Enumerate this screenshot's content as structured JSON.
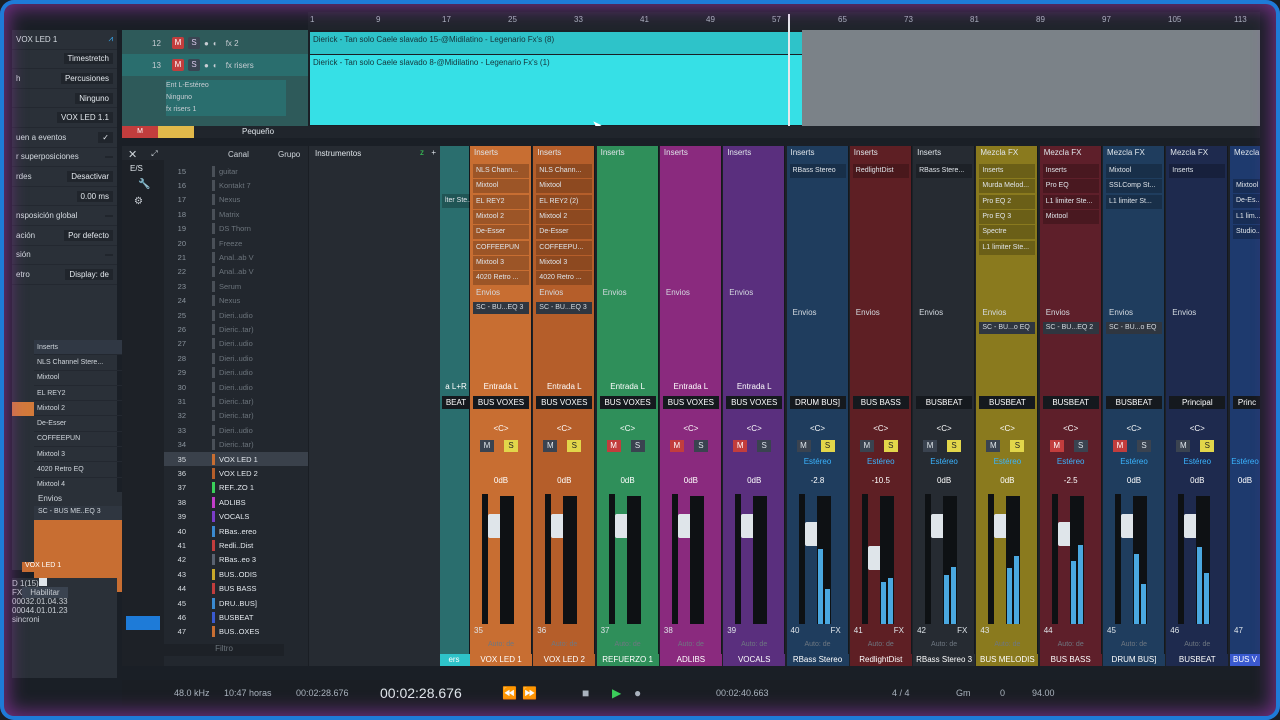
{
  "inspector": {
    "title": "VOX LED 1",
    "rows": [
      {
        "label": "",
        "value": "Timestretch"
      },
      {
        "label": "h",
        "value": "Percusiones"
      },
      {
        "label": "",
        "value": "Ninguno"
      },
      {
        "label": "",
        "value": "VOX LED 1.1"
      },
      {
        "label": "uen a eventos",
        "value": "✓"
      },
      {
        "label": "r superposiciones",
        "value": ""
      },
      {
        "label": "rdes",
        "value": "Desactivar"
      },
      {
        "label": "",
        "value": "0.00 ms"
      },
      {
        "label": "nsposición global",
        "value": ""
      },
      {
        "label": "ación",
        "value": "Por defecto"
      },
      {
        "label": "sión",
        "value": ""
      },
      {
        "label": "etro",
        "value": "Display: de"
      }
    ],
    "inserts_header": "Inserts",
    "inserts": [
      "NLS Channel Stere...",
      "Mixtool",
      "EL REY2",
      "Mixtool 2",
      "De-Esser",
      "COFFEEPUN",
      "Mixtool 3",
      "4020 Retro EQ",
      "Mixtool 4"
    ],
    "sends_header": "Envios",
    "send": "SC - BUS ME..EQ 3",
    "channel_label": "VOX LED 1",
    "bottom": {
      "event": "D 1(15)",
      "fx": "FX",
      "enable": "Habilitar",
      "t1": "00032.01.04.33",
      "t2": "00044.01.01.23",
      "sync": "sincroni"
    }
  },
  "arrange": {
    "tracks": [
      {
        "num": "12",
        "m": "M",
        "s": "S",
        "name": "fx 2"
      },
      {
        "num": "13",
        "m": "M",
        "s": "S",
        "name": "fx risers"
      }
    ],
    "track13_input": "Ent L-Estéreo",
    "track13_out": "Ninguno",
    "track13_sub": "fx risers 1",
    "ruler": [
      "1",
      "9",
      "17",
      "25",
      "33",
      "41",
      "49",
      "57",
      "65",
      "73",
      "81",
      "89",
      "97",
      "105",
      "113"
    ],
    "clip1": "Dierick - Tan solo Caele slavado 15-@Midilatino - Legenario Fx's (8)",
    "clip2": "Dierick - Tan solo Caele slavado 8-@Midilatino - Legenario Fx's (1)",
    "zoom": "Pequeño"
  },
  "list": {
    "headers": {
      "es": "E/S",
      "canal": "Canal",
      "grupo": "Grupo",
      "instr": "Instrumentos"
    },
    "filter": "Filtro",
    "aux": "AUX",
    "rows": [
      {
        "n": "15",
        "l": "guitar",
        "act": false
      },
      {
        "n": "16",
        "l": "Kontakt 7",
        "act": false
      },
      {
        "n": "17",
        "l": "Nexus",
        "act": false
      },
      {
        "n": "18",
        "l": "Matrix",
        "act": false
      },
      {
        "n": "19",
        "l": "DS Thorn",
        "act": false
      },
      {
        "n": "20",
        "l": "Freeze",
        "act": false
      },
      {
        "n": "21",
        "l": "Anal..ab V",
        "act": false
      },
      {
        "n": "22",
        "l": "Anal..ab V",
        "act": false
      },
      {
        "n": "23",
        "l": "Serum",
        "act": false
      },
      {
        "n": "24",
        "l": "Nexus",
        "act": false
      },
      {
        "n": "25",
        "l": "Dieri..udio",
        "act": false
      },
      {
        "n": "26",
        "l": "Dieric..tar)",
        "act": false
      },
      {
        "n": "27",
        "l": "Dieri..udio",
        "act": false
      },
      {
        "n": "28",
        "l": "Dieri..udio",
        "act": false
      },
      {
        "n": "29",
        "l": "Dieri..udio",
        "act": false
      },
      {
        "n": "30",
        "l": "Dieri..udio",
        "act": false
      },
      {
        "n": "31",
        "l": "Dieric..tar)",
        "act": false
      },
      {
        "n": "32",
        "l": "Dieric..tar)",
        "act": false
      },
      {
        "n": "33",
        "l": "Dieri..udio",
        "act": false
      },
      {
        "n": "34",
        "l": "Dieric..tar)",
        "act": false
      },
      {
        "n": "35",
        "l": "VOX LED 1",
        "act": true
      },
      {
        "n": "36",
        "l": "VOX LED 2",
        "act": true
      },
      {
        "n": "37",
        "l": "REF..ZO 1",
        "act": true
      },
      {
        "n": "38",
        "l": "ADLIBS",
        "act": true
      },
      {
        "n": "39",
        "l": "VOCALS",
        "act": true
      },
      {
        "n": "40",
        "l": "RBas..ereo",
        "act": true
      },
      {
        "n": "41",
        "l": "Redli..Dist",
        "act": true
      },
      {
        "n": "42",
        "l": "RBas..eo 3",
        "act": true
      },
      {
        "n": "43",
        "l": "BUS..ODIS",
        "act": true
      },
      {
        "n": "44",
        "l": "BUS BASS",
        "act": true
      },
      {
        "n": "45",
        "l": "DRU..BUS]",
        "act": true
      },
      {
        "n": "46",
        "l": "BUSBEAT",
        "act": true
      },
      {
        "n": "47",
        "l": "BUS..OXES",
        "act": true
      }
    ]
  },
  "mixer": {
    "partial_left": {
      "input": "a L+R",
      "bus": "BEAT",
      "name": "ers",
      "ins": "lter Ste...",
      "num": "3"
    },
    "channels": [
      {
        "num": "35",
        "color": "#c86e32",
        "top": "Inserts",
        "inserts": [
          "NLS Chann...",
          "Mixtool",
          "EL REY2",
          "Mixtool 2",
          "De-Esser",
          "COFFEEPUN",
          "Mixtool 3",
          "4020 Retro ..."
        ],
        "sends": "Envios",
        "send": "SC - BU...EQ 3",
        "input": "Entrada L",
        "bus": "BUS VOXES",
        "m": false,
        "s": true,
        "stereo": "",
        "gain": "0dB",
        "name": "VOX LED 1",
        "auto": "Auto: de",
        "fx": ""
      },
      {
        "num": "36",
        "color": "#b55e2a",
        "top": "Inserts",
        "inserts": [
          "NLS Chann...",
          "Mixtool",
          "EL REY2 (2)",
          "Mixtool 2",
          "De-Esser",
          "COFFEEPU...",
          "Mixtool 3",
          "4020 Retro ..."
        ],
        "sends": "Envios",
        "send": "SC - BU...EQ 3",
        "input": "Entrada L",
        "bus": "BUS VOXES",
        "m": false,
        "s": true,
        "stereo": "",
        "gain": "0dB",
        "name": "VOX LED 2",
        "auto": "Auto: de",
        "fx": ""
      },
      {
        "num": "37",
        "color": "#2f8f5a",
        "top": "Inserts",
        "inserts": [],
        "sends": "Envios",
        "send": "",
        "input": "Entrada L",
        "bus": "BUS VOXES",
        "m": true,
        "s": false,
        "stereo": "",
        "gain": "0dB",
        "name": "REFUERZO 1",
        "auto": "Auto: de",
        "fx": ""
      },
      {
        "num": "38",
        "color": "#8a2a7e",
        "top": "Inserts",
        "inserts": [],
        "sends": "Envios",
        "send": "",
        "input": "Entrada L",
        "bus": "BUS VOXES",
        "m": true,
        "s": false,
        "stereo": "",
        "gain": "0dB",
        "name": "ADLIBS",
        "auto": "Auto: de",
        "fx": ""
      },
      {
        "num": "39",
        "color": "#5a2f7e",
        "top": "Inserts",
        "inserts": [],
        "sends": "Envios",
        "send": "",
        "input": "Entrada L",
        "bus": "BUS VOXES",
        "m": true,
        "s": false,
        "stereo": "",
        "gain": "0dB",
        "name": "VOCALS",
        "auto": "Auto: de",
        "fx": ""
      },
      {
        "num": "40",
        "color": "#1f3d5e",
        "top": "Inserts",
        "inserts": [
          "RBass Stereo"
        ],
        "sends": "Envios",
        "send": "",
        "input": "",
        "bus": "DRUM BUS]",
        "m": false,
        "s": true,
        "stereo": "Estéreo",
        "gain": "-2.8",
        "name": "RBass Stereo",
        "auto": "Auto: de",
        "fx": "FX"
      },
      {
        "num": "41",
        "color": "#5e1f24",
        "top": "Inserts",
        "inserts": [
          "RedlightDist"
        ],
        "sends": "Envios",
        "send": "",
        "input": "",
        "bus": "BUS BASS",
        "m": false,
        "s": true,
        "stereo": "Estéreo",
        "gain": "-10.5",
        "name": "RedlightDist",
        "auto": "Auto: de",
        "fx": "FX"
      },
      {
        "num": "42",
        "color": "#262b32",
        "top": "Inserts",
        "inserts": [
          "RBass Stere..."
        ],
        "sends": "Envios",
        "send": "",
        "input": "",
        "bus": "BUSBEAT",
        "m": false,
        "s": true,
        "stereo": "Estéreo",
        "gain": "0dB",
        "name": "RBass Stereo 3",
        "auto": "Auto: de",
        "fx": "FX"
      },
      {
        "num": "43",
        "color": "#8a7a1e",
        "top": "Mezcla FX",
        "inserts": [
          "Inserts",
          "Murda Melod...",
          "Pro EQ 2",
          "Pro EQ 3",
          "Spectre",
          "L1 limiter Ste..."
        ],
        "sends": "Envios",
        "send": "SC - BU...o EQ",
        "input": "",
        "bus": "BUSBEAT",
        "m": false,
        "s": true,
        "stereo": "Estéreo",
        "gain": "0dB",
        "name": "BUS MELODIS",
        "auto": "Auto: de",
        "fx": ""
      },
      {
        "num": "44",
        "color": "#5e1f2a",
        "top": "Mezcla FX",
        "inserts": [
          "Inserts",
          "Pro EQ",
          "L1 limiter Ste...",
          "Mixtool"
        ],
        "sends": "Envios",
        "send": "SC - BU...EQ 2",
        "input": "",
        "bus": "BUSBEAT",
        "m": true,
        "s": false,
        "stereo": "Estéreo",
        "gain": "-2.5",
        "name": "BUS BASS",
        "auto": "Auto: de",
        "fx": ""
      },
      {
        "num": "45",
        "color": "#1f3d5e",
        "top": "Mezcla FX",
        "inserts": [
          "Mixtool",
          "SSLComp St...",
          "L1 limiter St..."
        ],
        "sends": "Envios",
        "send": "SC - BU...o EQ",
        "input": "",
        "bus": "BUSBEAT",
        "m": true,
        "s": false,
        "stereo": "Estéreo",
        "gain": "0dB",
        "name": "DRUM BUS]",
        "auto": "Auto: de",
        "fx": ""
      },
      {
        "num": "46",
        "color": "#1e2a4e",
        "top": "Mezcla FX",
        "inserts": [
          "Inserts"
        ],
        "sends": "Envios",
        "send": "",
        "input": "",
        "bus": "Principal",
        "m": false,
        "s": true,
        "stereo": "Estéreo",
        "gain": "0dB",
        "name": "BUSBEAT",
        "auto": "Auto: de",
        "fx": ""
      }
    ],
    "partial_right": {
      "num": "47",
      "top": "Mezcla",
      "inserts": [
        "Mixtool",
        "De-Es...",
        "L1 lim...",
        "Studio..."
      ],
      "bus": "Princ",
      "name": "BUS V",
      "gain": "0dB",
      "stereo": "Estéreo"
    }
  },
  "transport": {
    "rate": "48.0 kHz",
    "hours": "10:47 horas",
    "pos_small": "00:02:28.676",
    "pos_big": "00:02:28.676",
    "pos_right": "00:02:40.663",
    "meter": "4 / 4",
    "key": "Gm",
    "offset": "0",
    "tempo": "94.00"
  }
}
